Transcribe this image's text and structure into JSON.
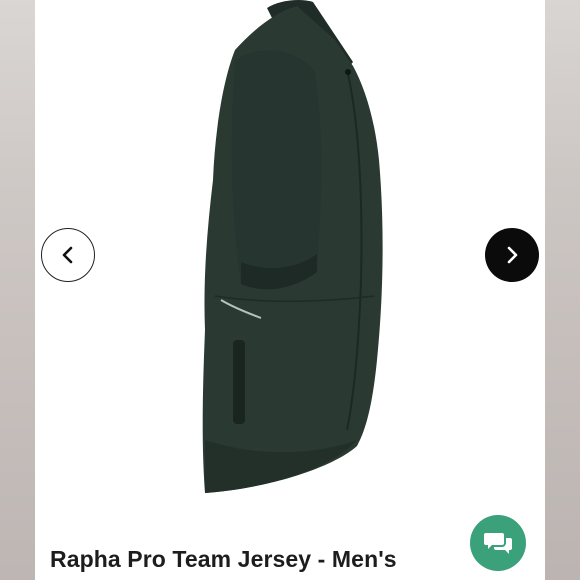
{
  "product": {
    "title": "Rapha Pro Team Jersey - Men's",
    "main_color": "#2a3a33"
  },
  "carousel": {
    "prev_icon": "chevron-left-icon",
    "next_icon": "chevron-right-icon"
  },
  "chat": {
    "icon": "chat-bubbles-icon",
    "color": "#3aa17a"
  }
}
